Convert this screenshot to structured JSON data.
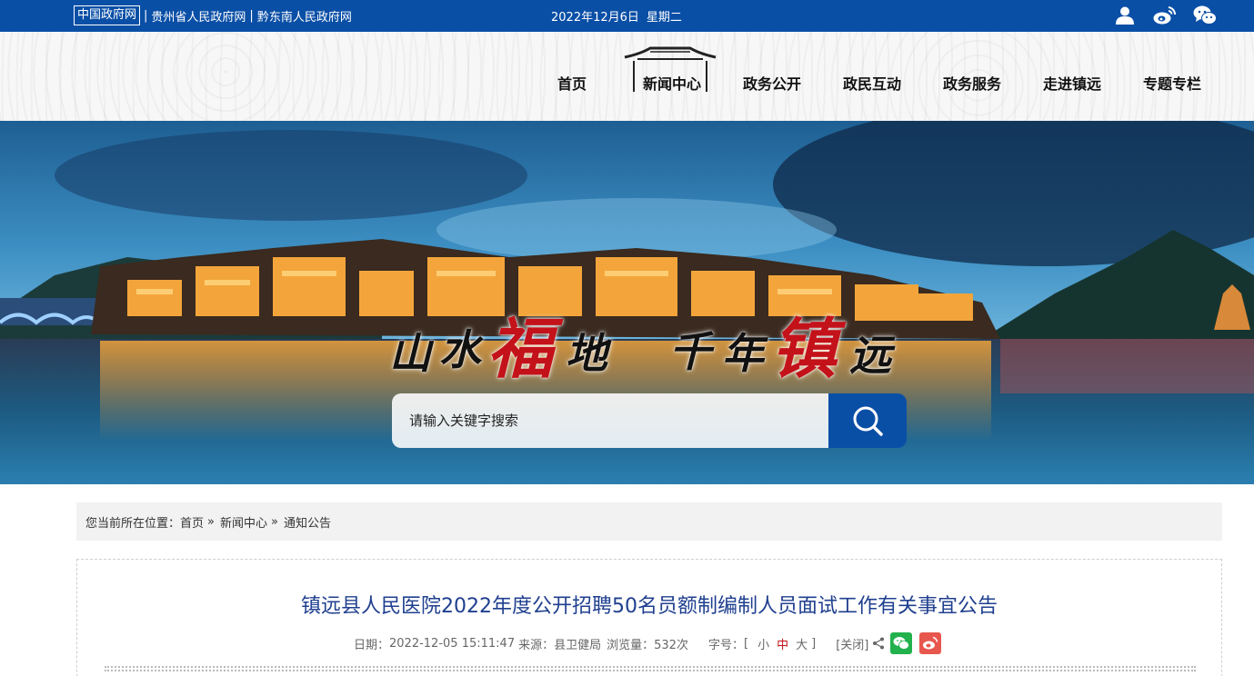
{
  "topbar": {
    "links": [
      "中国政府网",
      "贵州省人民政府网",
      "黔东南人民政府网"
    ],
    "separator": "|",
    "date": "2022年12月6日",
    "weekday": "星期二"
  },
  "nav": {
    "items": [
      "首页",
      "新闻中心",
      "政务公开",
      "政民互动",
      "政务服务",
      "走进镇远",
      "专题专栏"
    ],
    "active": "新闻中心"
  },
  "banner": {
    "slogan_left": [
      "山",
      "水",
      "福",
      "地"
    ],
    "slogan_right": [
      "千",
      "年",
      "镇",
      "远"
    ]
  },
  "search": {
    "placeholder": "请输入关键字搜索"
  },
  "breadcrumb": {
    "prefix": "您当前所在位置：",
    "items": [
      "首页",
      "新闻中心",
      "通知公告"
    ],
    "arrow": "»"
  },
  "article": {
    "title": "镇远县人民医院2022年度公开招聘50名员额制编制人员面试工作有关事宜公告",
    "date_label": "日期：",
    "date": "2022-12-05 15:11:47",
    "source_label": "来源：",
    "source": "县卫健局",
    "views_label": "浏览量：",
    "views": "532次",
    "font_label": "字号：",
    "font_sizes": [
      "小",
      "中",
      "大"
    ],
    "font_active": "中",
    "bracket_open": "[",
    "bracket_close": "]",
    "close_label": "[关闭]"
  },
  "colors": {
    "brand_blue": "#0a4fa6",
    "title_blue": "#1f3f8f",
    "accent_red": "#c4121a",
    "wechat_green": "#22b14c",
    "weibo_red": "#e8574e"
  },
  "icons": [
    "user-icon",
    "weibo-icon",
    "wechat-icon",
    "search-icon",
    "share-icon"
  ]
}
